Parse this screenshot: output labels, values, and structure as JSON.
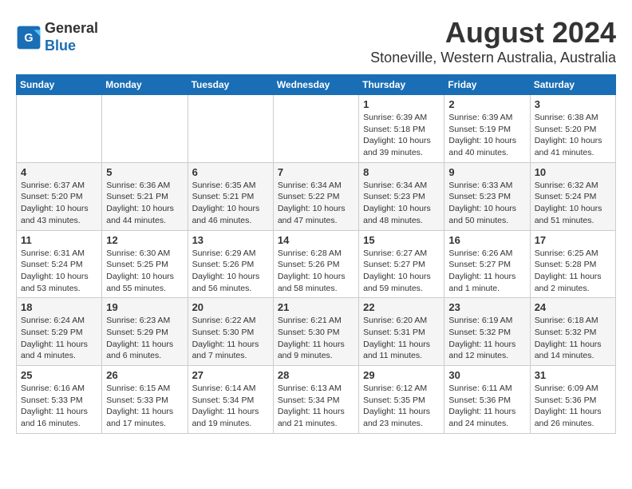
{
  "header": {
    "logo_general": "General",
    "logo_blue": "Blue",
    "title": "August 2024",
    "subtitle": "Stoneville, Western Australia, Australia"
  },
  "days_of_week": [
    "Sunday",
    "Monday",
    "Tuesday",
    "Wednesday",
    "Thursday",
    "Friday",
    "Saturday"
  ],
  "weeks": [
    [
      {
        "day": "",
        "info": ""
      },
      {
        "day": "",
        "info": ""
      },
      {
        "day": "",
        "info": ""
      },
      {
        "day": "",
        "info": ""
      },
      {
        "day": "1",
        "info": "Sunrise: 6:39 AM\nSunset: 5:18 PM\nDaylight: 10 hours and 39 minutes."
      },
      {
        "day": "2",
        "info": "Sunrise: 6:39 AM\nSunset: 5:19 PM\nDaylight: 10 hours and 40 minutes."
      },
      {
        "day": "3",
        "info": "Sunrise: 6:38 AM\nSunset: 5:20 PM\nDaylight: 10 hours and 41 minutes."
      }
    ],
    [
      {
        "day": "4",
        "info": "Sunrise: 6:37 AM\nSunset: 5:20 PM\nDaylight: 10 hours and 43 minutes."
      },
      {
        "day": "5",
        "info": "Sunrise: 6:36 AM\nSunset: 5:21 PM\nDaylight: 10 hours and 44 minutes."
      },
      {
        "day": "6",
        "info": "Sunrise: 6:35 AM\nSunset: 5:21 PM\nDaylight: 10 hours and 46 minutes."
      },
      {
        "day": "7",
        "info": "Sunrise: 6:34 AM\nSunset: 5:22 PM\nDaylight: 10 hours and 47 minutes."
      },
      {
        "day": "8",
        "info": "Sunrise: 6:34 AM\nSunset: 5:23 PM\nDaylight: 10 hours and 48 minutes."
      },
      {
        "day": "9",
        "info": "Sunrise: 6:33 AM\nSunset: 5:23 PM\nDaylight: 10 hours and 50 minutes."
      },
      {
        "day": "10",
        "info": "Sunrise: 6:32 AM\nSunset: 5:24 PM\nDaylight: 10 hours and 51 minutes."
      }
    ],
    [
      {
        "day": "11",
        "info": "Sunrise: 6:31 AM\nSunset: 5:24 PM\nDaylight: 10 hours and 53 minutes."
      },
      {
        "day": "12",
        "info": "Sunrise: 6:30 AM\nSunset: 5:25 PM\nDaylight: 10 hours and 55 minutes."
      },
      {
        "day": "13",
        "info": "Sunrise: 6:29 AM\nSunset: 5:26 PM\nDaylight: 10 hours and 56 minutes."
      },
      {
        "day": "14",
        "info": "Sunrise: 6:28 AM\nSunset: 5:26 PM\nDaylight: 10 hours and 58 minutes."
      },
      {
        "day": "15",
        "info": "Sunrise: 6:27 AM\nSunset: 5:27 PM\nDaylight: 10 hours and 59 minutes."
      },
      {
        "day": "16",
        "info": "Sunrise: 6:26 AM\nSunset: 5:27 PM\nDaylight: 11 hours and 1 minute."
      },
      {
        "day": "17",
        "info": "Sunrise: 6:25 AM\nSunset: 5:28 PM\nDaylight: 11 hours and 2 minutes."
      }
    ],
    [
      {
        "day": "18",
        "info": "Sunrise: 6:24 AM\nSunset: 5:29 PM\nDaylight: 11 hours and 4 minutes."
      },
      {
        "day": "19",
        "info": "Sunrise: 6:23 AM\nSunset: 5:29 PM\nDaylight: 11 hours and 6 minutes."
      },
      {
        "day": "20",
        "info": "Sunrise: 6:22 AM\nSunset: 5:30 PM\nDaylight: 11 hours and 7 minutes."
      },
      {
        "day": "21",
        "info": "Sunrise: 6:21 AM\nSunset: 5:30 PM\nDaylight: 11 hours and 9 minutes."
      },
      {
        "day": "22",
        "info": "Sunrise: 6:20 AM\nSunset: 5:31 PM\nDaylight: 11 hours and 11 minutes."
      },
      {
        "day": "23",
        "info": "Sunrise: 6:19 AM\nSunset: 5:32 PM\nDaylight: 11 hours and 12 minutes."
      },
      {
        "day": "24",
        "info": "Sunrise: 6:18 AM\nSunset: 5:32 PM\nDaylight: 11 hours and 14 minutes."
      }
    ],
    [
      {
        "day": "25",
        "info": "Sunrise: 6:16 AM\nSunset: 5:33 PM\nDaylight: 11 hours and 16 minutes."
      },
      {
        "day": "26",
        "info": "Sunrise: 6:15 AM\nSunset: 5:33 PM\nDaylight: 11 hours and 17 minutes."
      },
      {
        "day": "27",
        "info": "Sunrise: 6:14 AM\nSunset: 5:34 PM\nDaylight: 11 hours and 19 minutes."
      },
      {
        "day": "28",
        "info": "Sunrise: 6:13 AM\nSunset: 5:34 PM\nDaylight: 11 hours and 21 minutes."
      },
      {
        "day": "29",
        "info": "Sunrise: 6:12 AM\nSunset: 5:35 PM\nDaylight: 11 hours and 23 minutes."
      },
      {
        "day": "30",
        "info": "Sunrise: 6:11 AM\nSunset: 5:36 PM\nDaylight: 11 hours and 24 minutes."
      },
      {
        "day": "31",
        "info": "Sunrise: 6:09 AM\nSunset: 5:36 PM\nDaylight: 11 hours and 26 minutes."
      }
    ]
  ]
}
